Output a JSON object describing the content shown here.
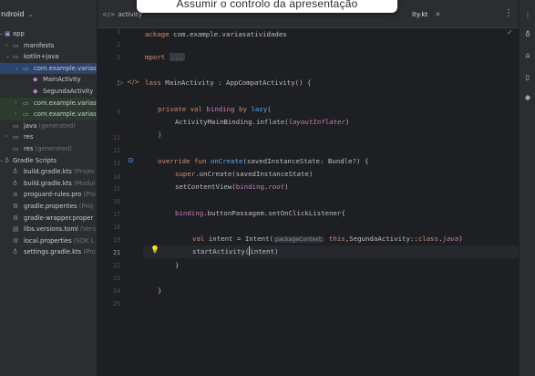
{
  "project": {
    "header": "ndroid",
    "items": [
      {
        "label": "app",
        "sub": ""
      },
      {
        "label": "manifests",
        "sub": ""
      },
      {
        "label": "kotlin+java",
        "sub": ""
      },
      {
        "label": "com.example.varias",
        "sub": ""
      },
      {
        "label": "MainActivity",
        "sub": ""
      },
      {
        "label": "SegundaActivity",
        "sub": ""
      },
      {
        "label": "com.example.varias",
        "sub": ""
      },
      {
        "label": "com.example.varias",
        "sub": ""
      },
      {
        "label": "java",
        "sub": "(generated)"
      },
      {
        "label": "res",
        "sub": ""
      },
      {
        "label": "res",
        "sub": "(generated)"
      },
      {
        "label": "Gradle Scripts",
        "sub": ""
      },
      {
        "label": "build.gradle.kts",
        "sub": "(Projec"
      },
      {
        "label": "build.gradle.kts",
        "sub": "(Modul"
      },
      {
        "label": "proguard-rules.pro",
        "sub": "(Pro"
      },
      {
        "label": "gradle.properties",
        "sub": "(Proj"
      },
      {
        "label": "gradle-wrapper.proper",
        "sub": ""
      },
      {
        "label": "libs.versions.toml",
        "sub": "(Vers"
      },
      {
        "label": "local.properties",
        "sub": "(SDK L"
      },
      {
        "label": "settings.gradle.kts",
        "sub": "(Pro"
      }
    ]
  },
  "tabs": {
    "first": "activity",
    "second": "ity.kt"
  },
  "tooltip": "Assumir o controlo da apresentação",
  "editor": {
    "line_numbers": [
      "1",
      "2",
      "3",
      "",
      "",
      "9",
      "10",
      "11",
      "12",
      "13",
      "14",
      "15",
      "16",
      "17",
      "18",
      "19",
      "20",
      "21",
      "22",
      "23",
      "24",
      "25"
    ],
    "current_line": "21",
    "code": {
      "l1_kw": "ackage",
      "l1_rest": " com.example.variasatividades",
      "l3_kw": "mport",
      "l3_fold": "...",
      "l9_kw": "lass",
      "l9_rest": " MainActivity : AppCompatActivity() {",
      "l10_kw1": "private",
      "l10_kw2": " val",
      "l10_name": " binding",
      "l10_by": " by",
      "l10_lazy": " lazy",
      "l10_brace": "{",
      "l11_a": "ActivityMainBinding.",
      "l11_fn": "inflate",
      "l11_b": "(",
      "l11_param": "layoutInflater",
      "l11_c": ")",
      "l12": "}",
      "l14_kw1": "override",
      "l14_kw2": " fun",
      "l14_fn": " onCreate",
      "l14_rest": "(savedInstanceState: Bundle?) {",
      "l15_kw": "super",
      "l15_rest": ".onCreate(savedInstanceState)",
      "l16_a": "setContentView(",
      "l16_b": "binding",
      "l16_c": ".",
      "l16_d": "root",
      "l16_e": ")",
      "l18_a": "binding",
      "l18_b": ".buttonPassagem.setOnClickListener{",
      "l20_kw": "val",
      "l20_a": " intent = Intent(",
      "l20_hint": "packageContext:",
      "l20_b": " this",
      "l20_c": ",SegundaActivity::",
      "l20_d": "class",
      "l20_e": ".",
      "l20_f": "java",
      "l20_g": ")",
      "l21_a": "startActivity(",
      "l21_b": "intent)",
      "l22": "}",
      "l24": "}"
    }
  },
  "colors": {
    "background": "#1e1f22",
    "panel": "#2b2d30",
    "keyword": "#cf8e6d",
    "function": "#56a8f5",
    "property": "#c77dbb",
    "selection": "#2e436e"
  },
  "icons": [
    "chevron-down-icon",
    "run-gutter-icon",
    "override-gutter-icon",
    "lightbulb-icon",
    "check-icon",
    "kebab-menu-icon",
    "gradle-icon",
    "notifications-icon",
    "ai-assistant-icon"
  ]
}
